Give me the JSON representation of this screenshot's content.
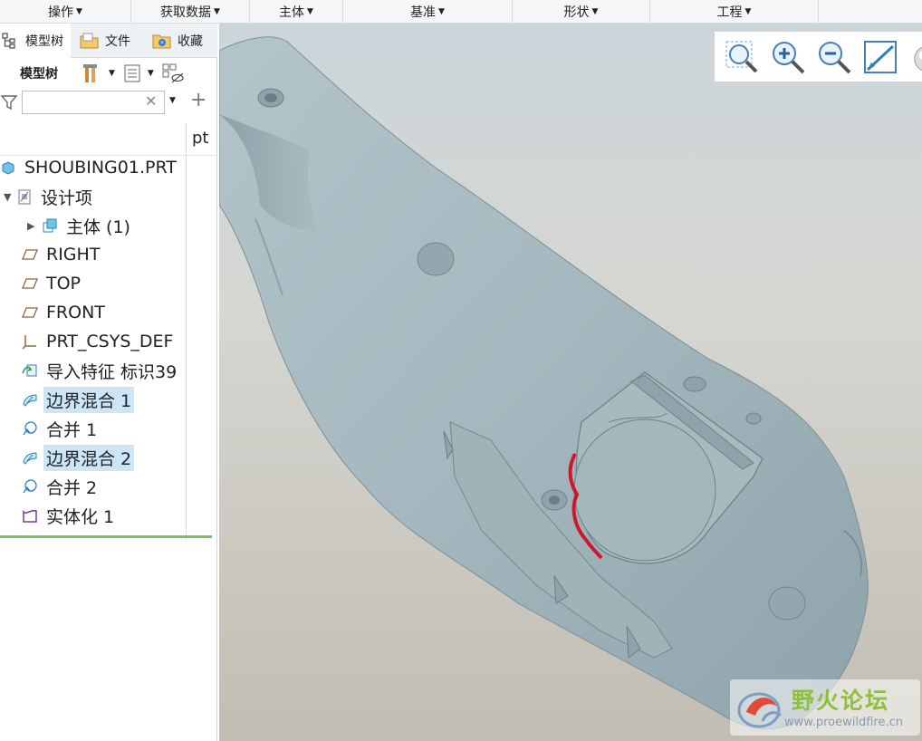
{
  "menubar": {
    "items": [
      {
        "label": "操作"
      },
      {
        "label": "获取数据"
      },
      {
        "label": "主体"
      },
      {
        "label": "基准"
      },
      {
        "label": "形状"
      },
      {
        "label": "工程"
      }
    ]
  },
  "sidebar": {
    "tabs": [
      {
        "label": "模型树",
        "icon": "model-tree-icon"
      },
      {
        "label": "文件",
        "icon": "folder-icon"
      },
      {
        "label": "收藏",
        "icon": "favorites-icon"
      }
    ],
    "toolbar": {
      "label": "模型树"
    },
    "filter": {
      "value": "",
      "placeholder": ""
    },
    "column_header": "pt",
    "tree": [
      {
        "label": "SHOUBING01.PRT",
        "icon": "part-icon",
        "expander": ""
      },
      {
        "label": "设计项",
        "icon": "design-items-icon",
        "expander": "▼"
      },
      {
        "label": "主体 (1)",
        "icon": "body-icon",
        "expander": "▶"
      },
      {
        "label": "RIGHT",
        "icon": "datum-plane-icon",
        "expander": ""
      },
      {
        "label": "TOP",
        "icon": "datum-plane-icon",
        "expander": ""
      },
      {
        "label": "FRONT",
        "icon": "datum-plane-icon",
        "expander": ""
      },
      {
        "label": "PRT_CSYS_DEF",
        "icon": "csys-icon",
        "expander": ""
      },
      {
        "label": "导入特征 标识39",
        "icon": "import-feature-icon",
        "expander": ""
      },
      {
        "label": "边界混合 1",
        "icon": "boundary-blend-icon",
        "expander": "",
        "selected": true
      },
      {
        "label": "合并 1",
        "icon": "merge-icon",
        "expander": ""
      },
      {
        "label": "边界混合 2",
        "icon": "boundary-blend-icon",
        "expander": "",
        "selected": true
      },
      {
        "label": "合并 2",
        "icon": "merge-icon",
        "expander": ""
      },
      {
        "label": "实体化 1",
        "icon": "solidify-icon",
        "expander": ""
      }
    ]
  },
  "viewport": {
    "tools": [
      {
        "name": "refit-icon"
      },
      {
        "name": "zoom-in-icon"
      },
      {
        "name": "zoom-out-icon"
      },
      {
        "name": "repaint-icon"
      },
      {
        "name": "display-style-icon"
      }
    ],
    "watermark": {
      "title": "野火论坛",
      "url": "www.proewildfire.cn"
    },
    "colors": {
      "model": "#a9bdc3",
      "highlight": "#d0162c",
      "bg_top": "#ccd5da",
      "bg_bottom": "#c2bdb2"
    }
  }
}
